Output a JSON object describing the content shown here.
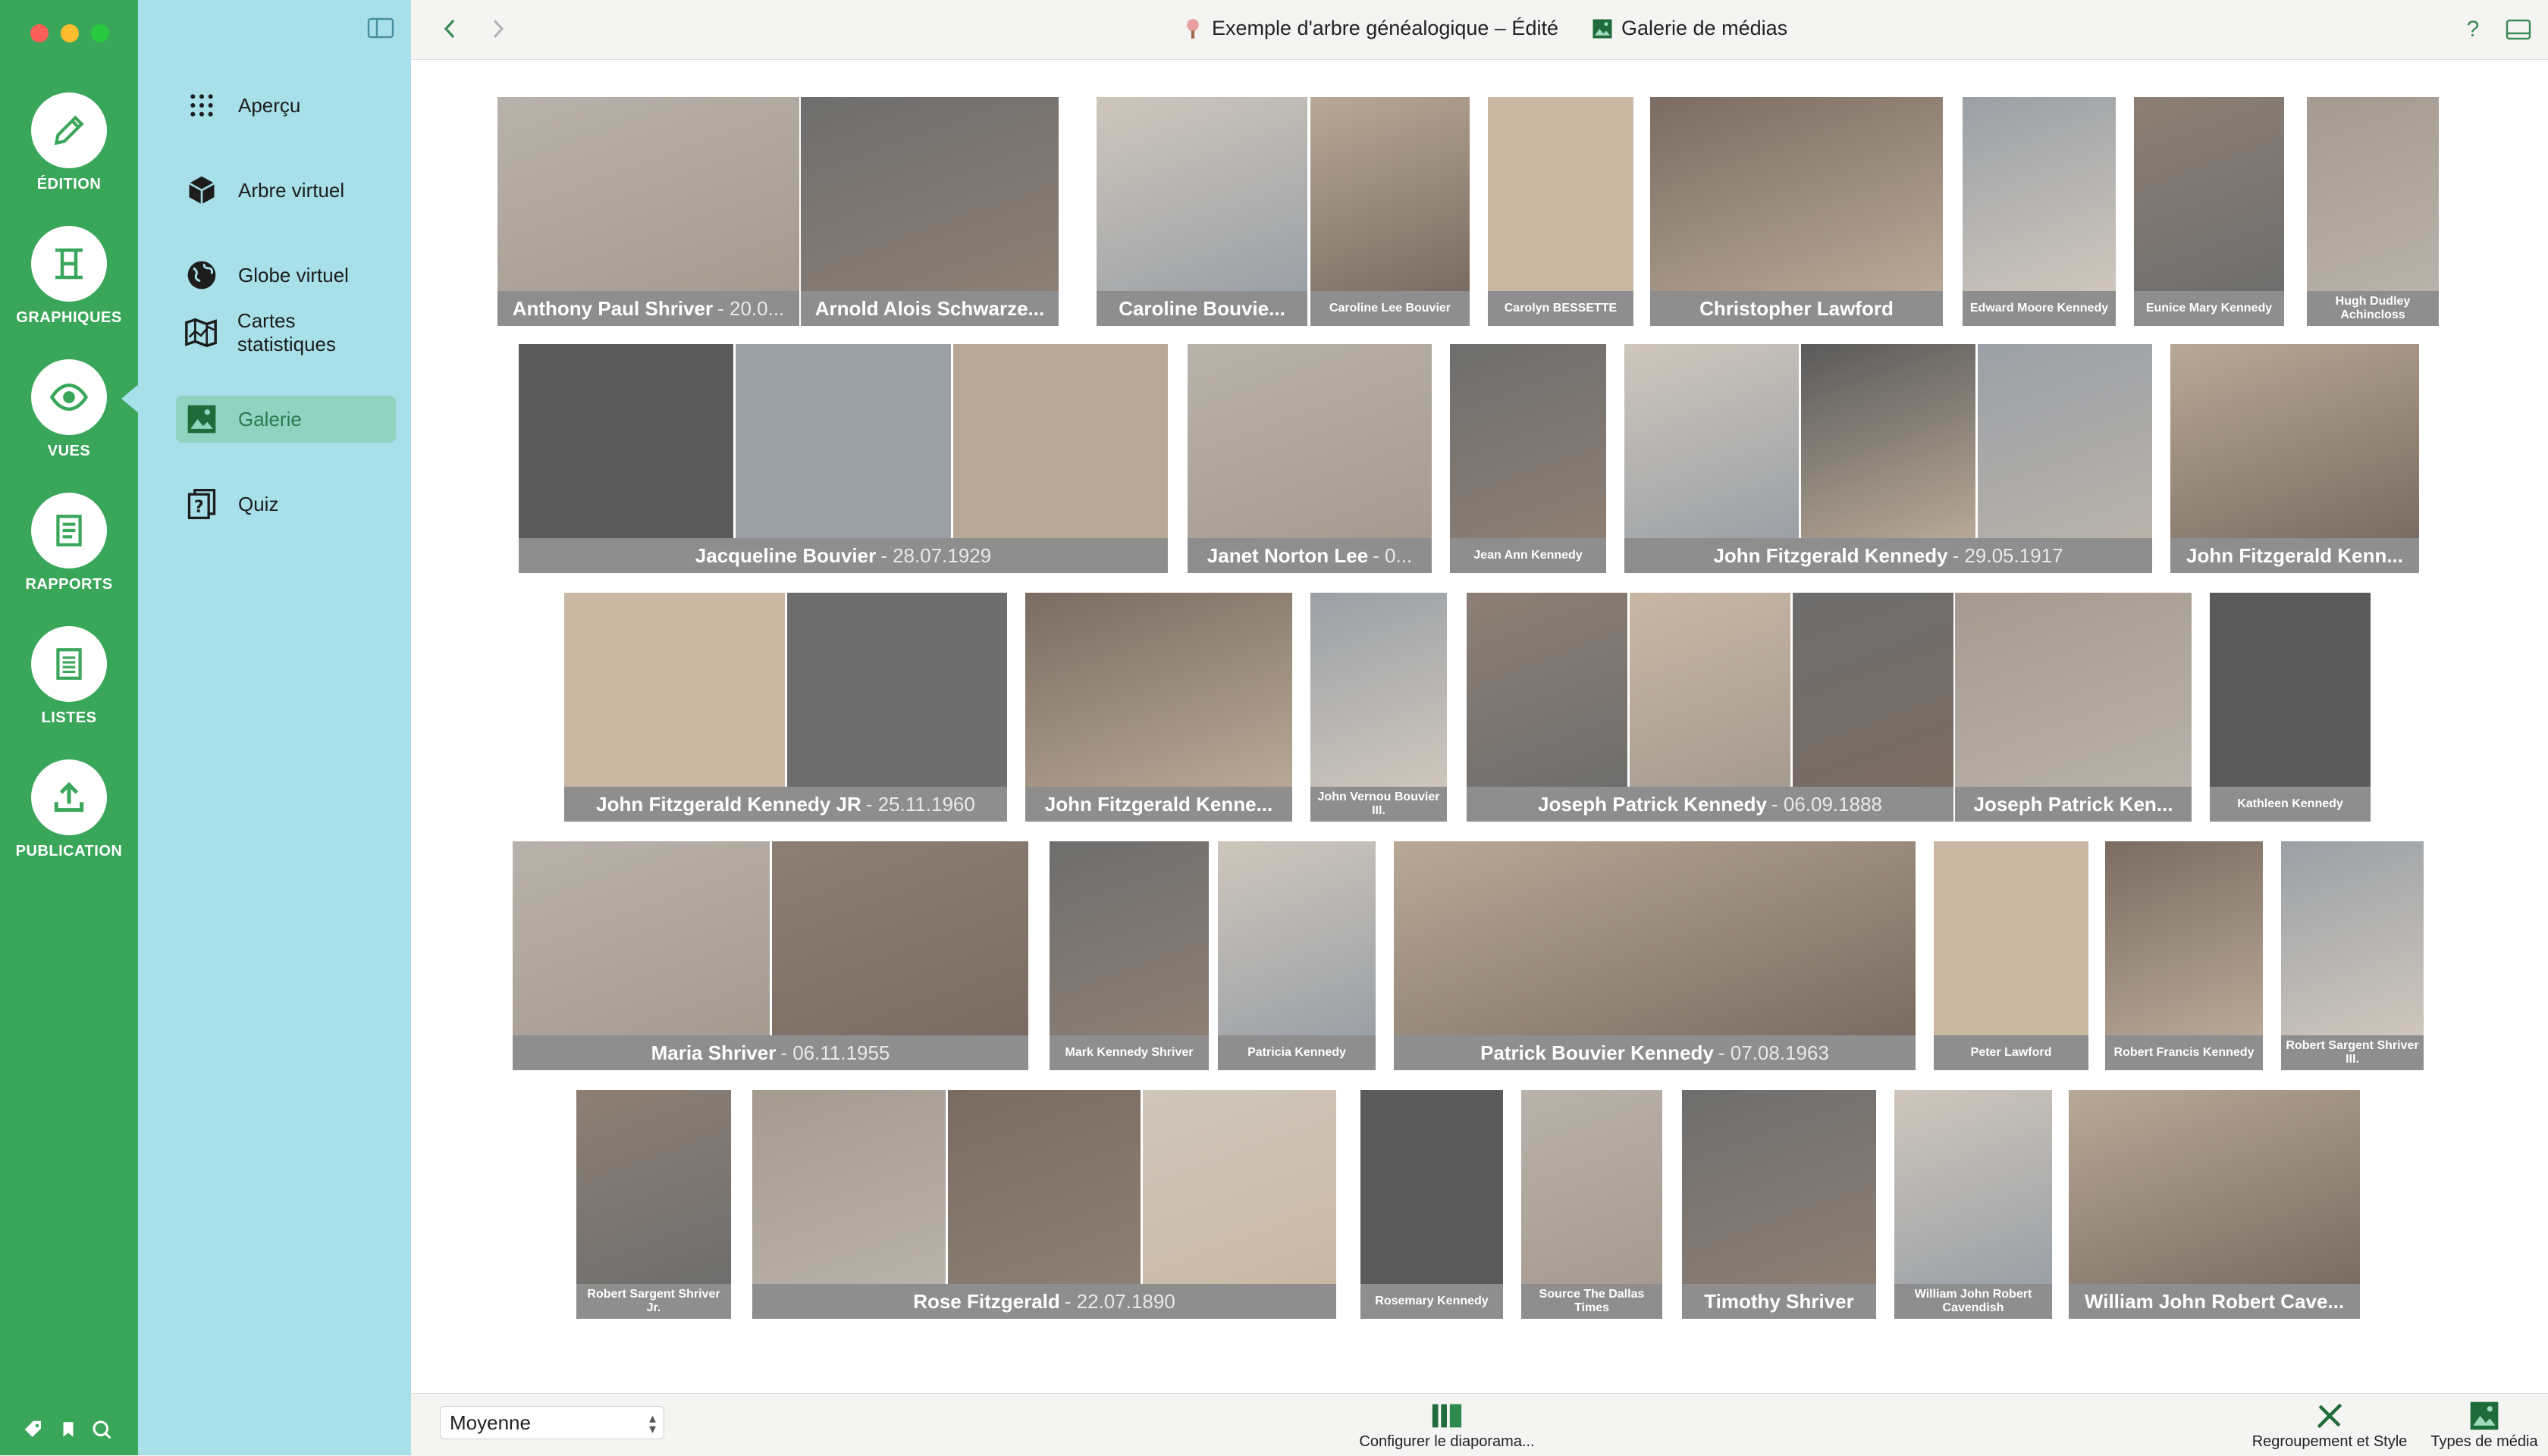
{
  "window": {
    "traffic_colors": [
      "#fe5f57",
      "#febc2e",
      "#28c840"
    ]
  },
  "rail": {
    "items": [
      {
        "label": "ÉDITION",
        "icon": "pencil-icon"
      },
      {
        "label": "GRAPHIQUES",
        "icon": "chart-tree-icon"
      },
      {
        "label": "VUES",
        "icon": "eye-icon"
      },
      {
        "label": "RAPPORTS",
        "icon": "report-icon"
      },
      {
        "label": "LISTES",
        "icon": "list-icon"
      },
      {
        "label": "PUBLICATION",
        "icon": "upload-icon"
      }
    ]
  },
  "sidebar": {
    "items": [
      {
        "label": "Aperçu",
        "icon": "grid-icon"
      },
      {
        "label": "Arbre virtuel",
        "icon": "cube-icon"
      },
      {
        "label": "Globe virtuel",
        "icon": "globe-icon"
      },
      {
        "label": "Cartes statistiques",
        "icon": "map-icon"
      },
      {
        "label": "Galerie",
        "icon": "gallery-icon",
        "active": true
      },
      {
        "label": "Quiz",
        "icon": "quiz-icon"
      }
    ]
  },
  "toolbar": {
    "document_title": "Exemple d'arbre généalogique – Édité",
    "view_title": "Galerie de médias",
    "help": "?"
  },
  "gallery": {
    "tiles": [
      {
        "name": "Anthony Paul Shriver",
        "date": "- 20.0...",
        "photos": 1
      },
      {
        "name": "Arnold Alois Schwarze...",
        "date": "",
        "photos": 1
      },
      {
        "name": "Caroline Bouvie...",
        "date": "",
        "photos": 1
      },
      {
        "name": "Caroline Lee Bouvier",
        "date": "",
        "photos": 1,
        "small": true
      },
      {
        "name": "Carolyn BESSETTE",
        "date": "",
        "photos": 1,
        "small": true
      },
      {
        "name": "Christopher Lawford",
        "date": "",
        "photos": 1
      },
      {
        "name": "Edward Moore Kennedy",
        "date": "",
        "photos": 1,
        "small": true
      },
      {
        "name": "Eunice Mary Kennedy",
        "date": "",
        "photos": 1,
        "small": true
      },
      {
        "name": "Hugh Dudley Achincloss",
        "date": "",
        "photos": 1,
        "small": true
      },
      {
        "name": "Jacqueline Bouvier",
        "date": "- 28.07.1929",
        "photos": 3
      },
      {
        "name": "Janet Norton Lee",
        "date": "- 0...",
        "photos": 1
      },
      {
        "name": "Jean Ann Kennedy",
        "date": "",
        "photos": 1,
        "small": true
      },
      {
        "name": "John Fitzgerald Kennedy",
        "date": "- 29.05.1917",
        "photos": 3
      },
      {
        "name": "John Fitzgerald Kenn...",
        "date": "",
        "photos": 1
      },
      {
        "name": "John Fitzgerald Kennedy JR",
        "date": "- 25.11.1960",
        "photos": 2
      },
      {
        "name": "John Fitzgerald Kenne...",
        "date": "",
        "photos": 1
      },
      {
        "name": "John Vernou Bouvier III.",
        "date": "",
        "photos": 1,
        "small": true
      },
      {
        "name": "Joseph Patrick Kennedy",
        "date": "- 06.09.1888",
        "photos": 3
      },
      {
        "name": "Joseph Patrick Ken...",
        "date": "",
        "photos": 1
      },
      {
        "name": "Kathleen Kennedy",
        "date": "",
        "photos": 1,
        "small": true
      },
      {
        "name": "Maria Shriver",
        "date": "- 06.11.1955",
        "photos": 2
      },
      {
        "name": "Mark Kennedy Shriver",
        "date": "",
        "photos": 1,
        "small": true
      },
      {
        "name": "Patricia Kennedy",
        "date": "",
        "photos": 1,
        "small": true
      },
      {
        "name": "Patrick Bouvier Kennedy",
        "date": "- 07.08.1963",
        "photos": 1
      },
      {
        "name": "Peter Lawford",
        "date": "",
        "photos": 1,
        "small": true
      },
      {
        "name": "Robert Francis Kennedy",
        "date": "",
        "photos": 1,
        "small": true
      },
      {
        "name": "Robert Sargent Shriver III.",
        "date": "",
        "photos": 1,
        "small": true
      },
      {
        "name": "Robert Sargent Shriver Jr.",
        "date": "",
        "photos": 1,
        "small": true
      },
      {
        "name": "Rose Fitzgerald",
        "date": "- 22.07.1890",
        "photos": 3
      },
      {
        "name": "Rosemary Kennedy",
        "date": "",
        "photos": 1,
        "small": true
      },
      {
        "name": "Source The Dallas Times",
        "date": "",
        "photos": 1,
        "small": true
      },
      {
        "name": "Timothy Shriver",
        "date": "",
        "photos": 1
      },
      {
        "name": "William John Robert Cavendish",
        "date": "",
        "photos": 1,
        "small": true
      },
      {
        "name": "William John Robert Cave...",
        "date": "",
        "photos": 1
      }
    ]
  },
  "bottom": {
    "zoom_value": "Moyenne",
    "slideshow_label": "Configurer le diaporama...",
    "grouping_label": "Regroupement et Style",
    "media_types_label": "Types de média"
  }
}
